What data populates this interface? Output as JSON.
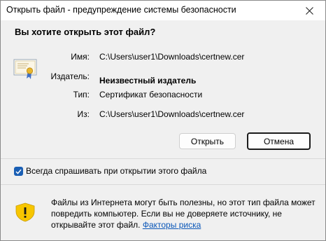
{
  "window": {
    "title": "Открыть файл - предупреждение системы безопасности"
  },
  "question": "Вы хотите открыть этот файл?",
  "fields": {
    "name_label": "Имя:",
    "name_value": "C:\\Users\\user1\\Downloads\\certnew.cer",
    "publisher_label": "Издатель:",
    "publisher_value": "Неизвестный издатель",
    "type_label": "Тип:",
    "type_value": "Сертификат безопасности",
    "from_label": "Из:",
    "from_value": "C:\\Users\\user1\\Downloads\\certnew.cer"
  },
  "buttons": {
    "open_label": "Открыть",
    "cancel_label": "Отмена"
  },
  "checkbox": {
    "label": "Всегда спрашивать при открытии этого файла",
    "checked": true
  },
  "warning": {
    "text_line1": "Файлы из Интернета могут быть полезны, но этот тип файла может",
    "text_line2": "повредить компьютер. Если вы не доверяете источнику, не",
    "text_line3": "открывайте этот файл.",
    "link_label": "Факторы риска"
  },
  "icons": {
    "close": "close-icon",
    "certificate": "certificate-icon",
    "warning": "shield-warning-icon",
    "checkmark": "checkmark-icon"
  },
  "colors": {
    "accent": "#1a5fb4",
    "link": "#0b57b8",
    "shield": "#f7c600"
  }
}
